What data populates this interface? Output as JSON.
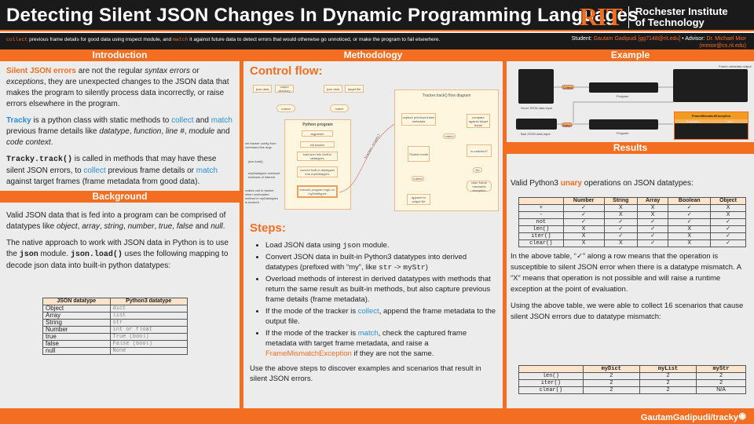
{
  "title": "Detecting Silent JSON Changes In Dynamic Programming Languages",
  "logo": {
    "rit": "RIT",
    "line1": "Rochester Institute",
    "line2": "of Technology"
  },
  "subtitle": {
    "collect": "collect",
    "t1": " previous frame details for good data using inspect module, and ",
    "match": "match",
    "t2": " it against future data to detect errors that would otherwise go unnoticed, or make the program to fail elsewhere.",
    "student_label": "Student: ",
    "student": "Gautam Gadipudi [gg7148@rit.edu]",
    "advisor_label": " • Advisor: ",
    "advisor": "Dr. Michael Mior",
    "advisor_email": "(mmior@cs.rit.edu)"
  },
  "sections": {
    "intro": "Introduction",
    "background": "Background",
    "methodology": "Methodology",
    "example": "Example",
    "results": "Results"
  },
  "intro": {
    "p1": {
      "a": "Silent JSON errors",
      "b": " are not the regular ",
      "c": "syntax errors",
      "d": " or ",
      "e": "exceptions",
      "f": ", they are unexpected changes to the JSON data that makes the program to silently process data incorrectly, or raise errors elsewhere in the program."
    },
    "p2": {
      "a": "Tracky",
      "b": " is a python class with static methods to ",
      "c": "collect",
      "d": " and ",
      "e": "match",
      "f": " previous frame details like ",
      "g": "datatype",
      "h": ", ",
      "i": "function",
      "j": ", ",
      "k": "line #",
      "l": ", ",
      "m": "module",
      "n": " and ",
      "o": "code context",
      "p": "."
    },
    "p3": {
      "a": "Tracky.track()",
      "b": " is called in methods that may have these silent JSON errors, to ",
      "c": "collect",
      "d": " previous frame details or ",
      "e": "match",
      "f": " against target frames (frame metadata from good data)."
    }
  },
  "background": {
    "p1": {
      "a": "Valid JSON data that is fed into a program can be comprised of datatypes like ",
      "b": "object",
      "c": ", ",
      "d": "array",
      "e": ", ",
      "f": "string",
      "g": ", ",
      "h": "number",
      "i": ", ",
      "j": "true",
      "k": ", ",
      "l": "false",
      "m": " and ",
      "n": "null",
      "o": "."
    },
    "p2": {
      "a": "The native approach to work with JSON data in Python is to use the ",
      "b": "json",
      "c": " module. ",
      "d": "json.load()",
      "e": " uses the following mapping to decode json data into built-in python datatypes:"
    },
    "table": {
      "headers": [
        "JSON datatype",
        "Python3 datatype"
      ],
      "rows": [
        [
          "Object",
          "dict"
        ],
        [
          "Array",
          "list"
        ],
        [
          "String",
          "str"
        ],
        [
          "Number",
          "int or float"
        ],
        [
          "true",
          "True (bool)"
        ],
        [
          "false",
          "False (bool)"
        ],
        [
          "null",
          "None"
        ]
      ]
    }
  },
  "methodology": {
    "control_flow": "Control flow:",
    "diagram": {
      "inputs": [
        "json data",
        "output directory",
        "json data",
        "target file"
      ],
      "modes": [
        "collect",
        "match"
      ],
      "program_title": "Python program",
      "program_steps": [
        "argparser",
        "init tracker",
        "load json into built-in datatypes",
        "convert built-in datatypes into myDatatypes",
        "execute program logic on myDatatypes"
      ],
      "side_notes": [
        "set tracker config from command line args",
        "json.load()",
        "myDatatypes overload methods of interest",
        "makes call to tracker when overloaded method in myDatatypes is invoked"
      ],
      "call_label": "Tracker.track()",
      "flow_title": "Tracker.track() flow diagram",
      "flow_nodes": [
        "capture previous frame metadata",
        "Tracker mode",
        "collect",
        "append to output file",
        "match",
        "compare against target frame",
        "is matched?",
        "No",
        "raise frame mismatch exception"
      ]
    },
    "steps_title": "Steps:",
    "steps": [
      {
        "a": "Load JSON data using ",
        "b": "json",
        "c": " module."
      },
      {
        "a": "Convert JSON data in built-in Python3 datatypes into derived datatypes (prefixed with “my”, like ",
        "b": "str",
        "c": " -> ",
        "d": "myStr",
        "e": ")"
      },
      {
        "a": "Overload methods of interest in derived datatypes with methods that return the same result as built-in methods, but also  capture previous frame details (frame metadata)."
      },
      {
        "a": "If the mode of the tracker is ",
        "b": "collect",
        "c": ", append the frame metadata to the output file."
      },
      {
        "a": "If the mode of the tracker is ",
        "b": "match",
        "c": ", check the captured frame metadata with target frame metadata, and raise a ",
        "d": "FrameMismatchException",
        "e": " if they are not the same."
      }
    ],
    "closing": "Use the above steps to discover examples and scenarios that result in silent JSON errors."
  },
  "example": {
    "good_caption": "Good JSON data input",
    "bad_caption": "Bad JSON data input",
    "program_caption": "Program",
    "collect": "Collect",
    "match": "Match",
    "output_caption": "Frame metadata output",
    "exception_title": "FrameMismatchException",
    "exception_cols": [
      "Expected",
      "Got"
    ]
  },
  "results": {
    "intro": {
      "a": "Valid Python3 ",
      "b": "unary",
      "c": " operations on JSON datatypes:"
    },
    "table1": {
      "headers": [
        "",
        "Number",
        "String",
        "Array",
        "Boolean",
        "Object"
      ],
      "rows": [
        [
          "+",
          "✓",
          "X",
          "X",
          "✓",
          "X"
        ],
        [
          "-",
          "✓",
          "X",
          "X",
          "✓",
          "X"
        ],
        [
          "not",
          "✓",
          "✓",
          "✓",
          "✓",
          "✓"
        ],
        [
          "len()",
          "X",
          "✓",
          "✓",
          "X",
          "✓"
        ],
        [
          "iter()",
          "X",
          "✓",
          "✓",
          "X",
          "✓"
        ],
        [
          "clear()",
          "X",
          "X",
          "✓",
          "X",
          "✓"
        ]
      ]
    },
    "p1": "In the above table, “✓” along a row means that the operation is susceptible to silent JSON error when there is a datatype mismatch. A “X” means that operation is not possible and will raise a runtime exception at the point of evaluation.",
    "p2": "Using the above table, we were able to collect 16 scenarios that cause silent JSON errors due to datatype mismatch:",
    "table2": {
      "headers": [
        "",
        "myDict",
        "myList",
        "myStr"
      ],
      "rows": [
        [
          "len()",
          "2",
          "2",
          "2"
        ],
        [
          "iter()",
          "2",
          "2",
          "2"
        ],
        [
          "clear()",
          "2",
          "2",
          "N/A"
        ]
      ]
    }
  },
  "footer": {
    "github": "GautamGadipudi/tracky"
  }
}
